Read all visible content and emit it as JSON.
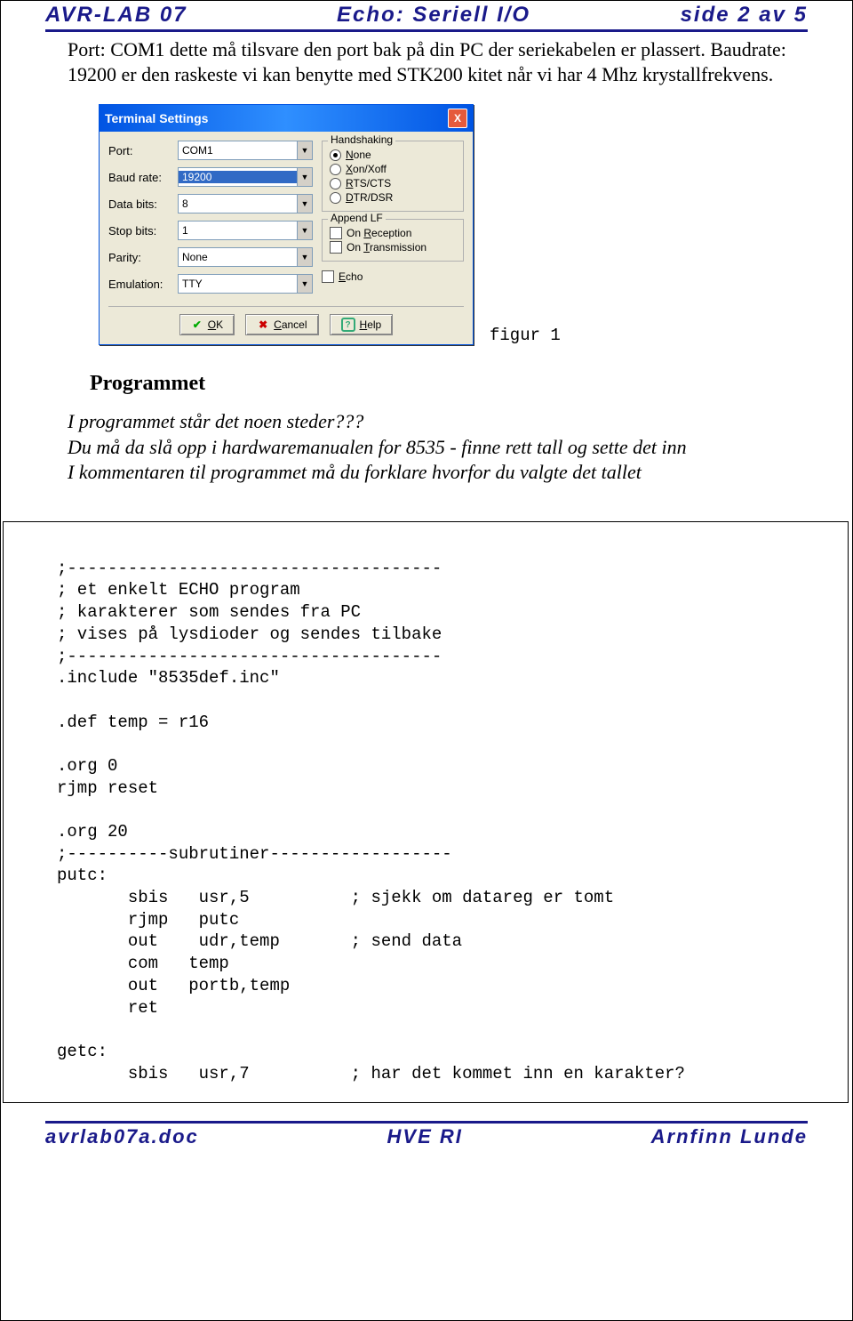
{
  "header": {
    "left": "AVR-LAB 07",
    "center": "Echo:  Seriell I/O",
    "right": "side 2 av 5"
  },
  "intro": {
    "para": "Port: COM1  dette må tilsvare den port bak på din PC der seriekabelen er plassert. Baudrate: 19200 er den raskeste vi kan benytte med STK200 kitet når vi har 4 Mhz krystallfrekvens."
  },
  "dialog": {
    "title": "Terminal Settings",
    "close": "X",
    "fields": {
      "port": {
        "label": "Port:",
        "value": "COM1"
      },
      "baud": {
        "label": "Baud rate:",
        "value": "19200"
      },
      "databits": {
        "label": "Data bits:",
        "value": "8"
      },
      "stopbits": {
        "label": "Stop bits:",
        "value": "1"
      },
      "parity": {
        "label": "Parity:",
        "value": "None"
      },
      "emulation": {
        "label": "Emulation:",
        "value": "TTY"
      }
    },
    "handshaking": {
      "legend": "Handshaking",
      "none_pre": "N",
      "none_rest": "one",
      "xon_pre": "X",
      "xon_rest": "on/Xoff",
      "rts_pre": "R",
      "rts_rest": "TS/CTS",
      "dtr_pre": "D",
      "dtr_rest": "TR/DSR"
    },
    "appendlf": {
      "legend": "Append LF",
      "onrec_pre": "On ",
      "onrec_u": "R",
      "onrec_rest": "eception",
      "ontr_pre": "On ",
      "ontr_u": "T",
      "ontr_rest": "ransmission"
    },
    "echo_u": "E",
    "echo_rest": "cho",
    "buttons": {
      "ok_u": "O",
      "ok_rest": "K",
      "cancel_u": "C",
      "cancel_rest": "ancel",
      "help_u": "H",
      "help_rest": "elp"
    }
  },
  "fig_caption": "figur 1",
  "section_heading": "Programmet",
  "notes": {
    "line1": "I programmet står det noen steder???",
    "line2": "Du må da slå opp i hardwaremanualen for 8535 - finne rett tall og sette det inn",
    "line3": "I kommentaren til programmet må du forklare hvorfor du valgte det tallet"
  },
  "code": ";-------------------------------------\n; et enkelt ECHO program\n; karakterer som sendes fra PC\n; vises på lysdioder og sendes tilbake\n;-------------------------------------\n.include \"8535def.inc\"\n\n.def temp = r16\n\n.org 0\nrjmp reset\n\n.org 20\n;----------subrutiner------------------\nputc:\n       sbis   usr,5          ; sjekk om datareg er tomt\n       rjmp   putc\n       out    udr,temp       ; send data\n       com   temp\n       out   portb,temp\n       ret\n\ngetc:\n       sbis   usr,7          ; har det kommet inn en karakter?",
  "footer": {
    "left": "avrlab07a.doc",
    "center": "HVE RI",
    "right": "Arnfinn Lunde"
  }
}
